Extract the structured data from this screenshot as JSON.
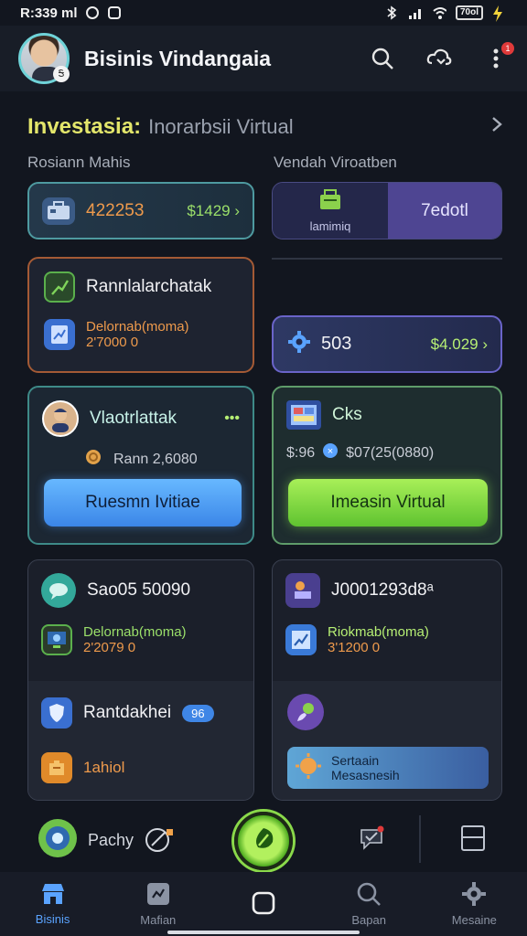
{
  "status": {
    "time": "R:339 ml",
    "battery": "70ol"
  },
  "appbar": {
    "title": "Bisinis Vindangaia",
    "avatar_badge": "Ꭶ",
    "notif_count": "1"
  },
  "section": {
    "title_bold": "Investasia:",
    "title_rest": "Inorarbsii Virtual",
    "left_sub": "Rosiann Mahis",
    "right_sub": "Vendah Viroatben"
  },
  "card_teal": {
    "amount": "422253",
    "value": "$1429 ›"
  },
  "card_violet": {
    "label_small": "lamimiq",
    "label_right": "7edotl"
  },
  "card_orange": {
    "title": "Rannlalarchatak",
    "line1": "Delornab(moma)",
    "line2": "2'7000 0"
  },
  "card_blue": {
    "number": "503",
    "value": "$4.029 ›"
  },
  "card_teal2": {
    "title": "Vlaotrlattak",
    "dots": "•••",
    "coin": "Rann 2,6080",
    "button": "Ruesmn Ivitiae"
  },
  "card_green": {
    "title": "Cks",
    "left_val": "$:96",
    "right_val": "$07(25(0880)",
    "button": "Imeasin Virtual"
  },
  "card_dark1": {
    "title": "Sao05 50090",
    "line1": "Delornab(moma)",
    "line2": "2'2079 0",
    "row2": "Rantdakhei",
    "chip": "96",
    "row3": "1ahiol"
  },
  "card_dark2": {
    "title": "J0001293d8ᵃ",
    "line1": "Riokmab(moma)",
    "line2": "3'1200 0",
    "banner1": "Sertaain",
    "banner2": "Mesasnesih"
  },
  "quick": {
    "label": "Pachy"
  },
  "nav": [
    {
      "label": "Bisinis",
      "icon": "store-icon"
    },
    {
      "label": "Mafian",
      "icon": "puzzle-icon"
    },
    {
      "label": "",
      "icon": "home-square-icon"
    },
    {
      "label": "Bapan",
      "icon": "search-icon"
    },
    {
      "label": "Mesaine",
      "icon": "gear-icon"
    }
  ],
  "colors": {
    "accent_green": "#9be06a",
    "accent_blue": "#5aa3ff",
    "accent_yellow": "#e3e66b"
  }
}
